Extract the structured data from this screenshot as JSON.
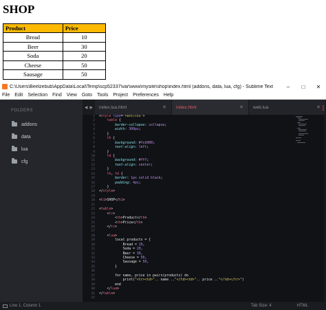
{
  "preview": {
    "heading": "SHOP",
    "table": {
      "headers": [
        "Product",
        "Price"
      ],
      "rows": [
        [
          "Bread",
          "10"
        ],
        [
          "Beer",
          "30"
        ],
        [
          "Soda",
          "20"
        ],
        [
          "Cheese",
          "50"
        ],
        [
          "Sausage",
          "50"
        ]
      ]
    },
    "colors": {
      "header_bg": "#fcb900"
    }
  },
  "window": {
    "title": "C:\\Users\\Beelzebub\\AppData\\Local\\Temp\\scp52337\\var\\www\\mysite\\shop\\index.html (addons, data, lua, cfg) - Sublime Text",
    "controls": [
      "–",
      "□",
      "✕"
    ],
    "menu": [
      "File",
      "Edit",
      "Selection",
      "Find",
      "View",
      "Goto",
      "Tools",
      "Project",
      "Preferences",
      "Help"
    ]
  },
  "sidebar": {
    "heading": "FOLDERS",
    "items": [
      "addons",
      "data",
      "lua",
      "cfg"
    ]
  },
  "tabs": [
    {
      "label": "index.lua.html",
      "active": false
    },
    {
      "label": "index.html",
      "active": true
    },
    {
      "label": "web.lua",
      "active": false
    }
  ],
  "editor": {
    "line_count": 42
  },
  "status": {
    "position": "Line 1, Column 1",
    "tab_size": "Tab Size: 4",
    "syntax": "HTML"
  }
}
